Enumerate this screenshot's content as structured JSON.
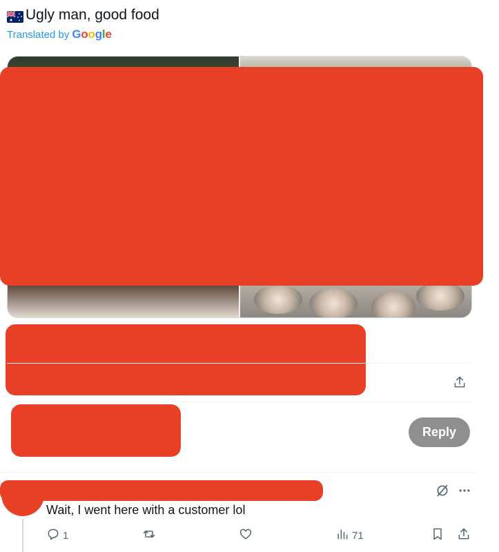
{
  "tweet": {
    "flag_icon": "australia-flag-icon",
    "text": "Ugly man, good food",
    "translated_prefix": "Translated by",
    "translator": "Google",
    "translator_colors": [
      "#4285F4",
      "#EA4335",
      "#FBBC05",
      "#4285F4",
      "#34A853",
      "#EA4335"
    ]
  },
  "media": {
    "photos": [
      "garnished-dish-photo",
      "salad-photo",
      "steak-photo",
      "oysters-photo"
    ]
  },
  "redaction_color": "#e84026",
  "reply_composer": {
    "reply_label": "Reply"
  },
  "reply_tweet": {
    "text": "Wait, I went here with a customer lol",
    "reply_count": "1",
    "views": "71"
  },
  "icons": {
    "share": "share-icon",
    "grok": "grok-icon",
    "more": "more-icon",
    "reply": "reply-icon",
    "retweet": "retweet-icon",
    "like": "like-icon",
    "views": "views-icon",
    "bookmark": "bookmark-icon"
  },
  "colors": {
    "accent": "#1d9bf0",
    "muted": "#536471",
    "reply_button_bg": "#8f8f8f"
  }
}
